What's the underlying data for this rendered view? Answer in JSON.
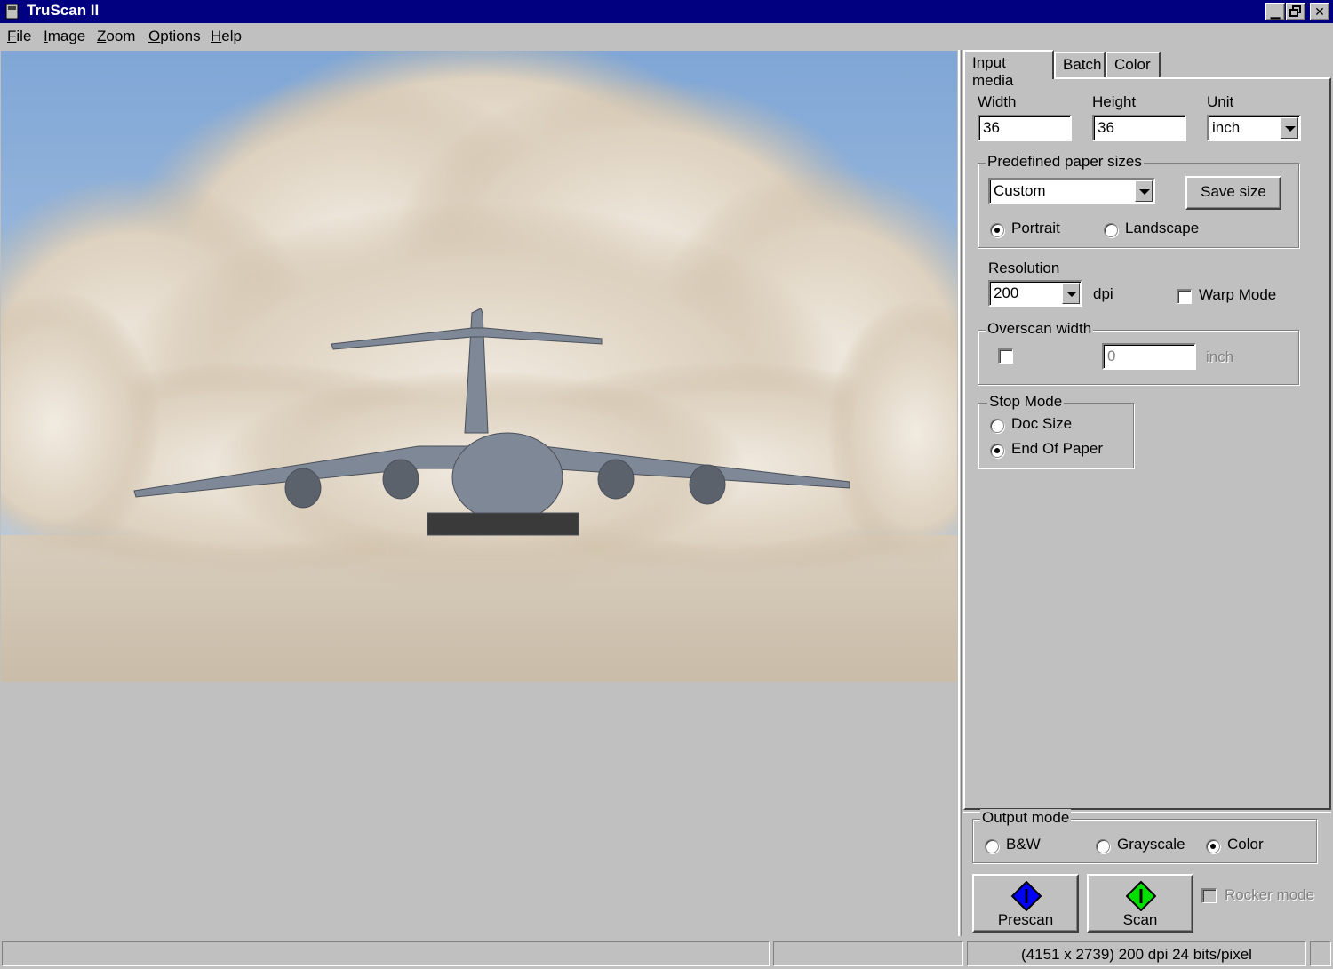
{
  "window": {
    "title": "TruScan II"
  },
  "menu": {
    "items": [
      {
        "key": "F",
        "rest": "ile"
      },
      {
        "key": "I",
        "rest": "mage"
      },
      {
        "key": "Z",
        "rest": "oom"
      },
      {
        "key": "O",
        "rest": "ptions"
      },
      {
        "key": "H",
        "rest": "elp"
      }
    ]
  },
  "tabs": [
    {
      "label": "Input media"
    },
    {
      "label": "Batch"
    },
    {
      "label": "Color"
    }
  ],
  "input_media": {
    "width_label": "Width",
    "width_value": "36",
    "height_label": "Height",
    "height_value": "36",
    "unit_label": "Unit",
    "unit_value": "inch",
    "paper_group_label": "Predefined paper sizes",
    "paper_size_value": "Custom",
    "save_size_label": "Save size",
    "portrait_label": "Portrait",
    "landscape_label": "Landscape",
    "resolution_label": "Resolution",
    "resolution_value": "200",
    "dpi_label": "dpi",
    "warp_mode_label": "Warp Mode",
    "overscan_group_label": "Overscan width",
    "overscan_value": "0",
    "overscan_unit": "inch",
    "stop_mode_group_label": "Stop Mode",
    "doc_size_label": "Doc Size",
    "end_of_paper_label": "End Of Paper"
  },
  "output": {
    "group_label": "Output mode",
    "bw_label": "B&W",
    "grayscale_label": "Grayscale",
    "color_label": "Color",
    "prescan_label": "Prescan",
    "scan_label": "Scan",
    "rocker_mode_label": "Rocker mode"
  },
  "colors": {
    "prescan_icon": "#0000ff",
    "scan_icon": "#00e000"
  },
  "status": {
    "pane1": "",
    "pane2": "",
    "pane3": "(4151 x 2739) 200 dpi 24 bits/pixel"
  }
}
